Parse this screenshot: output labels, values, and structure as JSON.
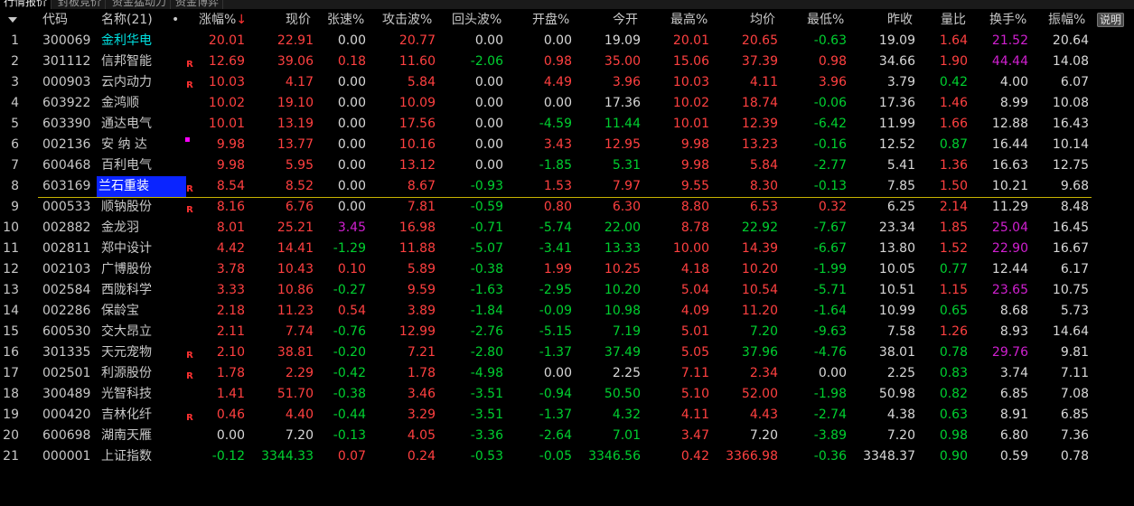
{
  "tabs": [
    "行情报价",
    "封板竞价",
    "资金猛动力",
    "资金博弈"
  ],
  "header": {
    "idx_blank": "",
    "code": "代码",
    "name": "名称(21)",
    "dot": "•",
    "zhangfu": "涨幅%",
    "sort_arrow": "↓",
    "xianjia": "现价",
    "zhangsu": "张速%",
    "gongji": "攻击波%",
    "huitou": "回头波%",
    "kaipan": "开盘%",
    "jinkai": "今开",
    "zuigao": "最高%",
    "junjia": "均价",
    "zuidi": "最低%",
    "zuoshou": "昨收",
    "liangbi": "量比",
    "huanshou": "换手%",
    "zhenfu": "振幅%",
    "help": "说明"
  },
  "colors": {
    "up": "#ff4040",
    "down": "#00d030",
    "flat": "#d8d8d8",
    "highlight": "#d020d0",
    "selection": "#0a24ff",
    "cyan": "#00e0e0"
  },
  "rows": [
    {
      "idx": "1",
      "code": "300069",
      "name": "金利华电",
      "mark": "",
      "zf": "20.01",
      "xj": "22.91",
      "zs": "0.00",
      "gj": "20.77",
      "ht": "0.00",
      "kp": "0.00",
      "jk": "19.09",
      "zg": "20.01",
      "jj": "20.65",
      "zd": "-0.63",
      "zs2": "19.09",
      "lb": "1.64",
      "hs": "21.52",
      "zhf": "20.64"
    },
    {
      "idx": "2",
      "code": "301112",
      "name": "信邦智能",
      "mark": "R",
      "zf": "12.69",
      "xj": "39.06",
      "zs": "0.18",
      "gj": "11.60",
      "ht": "-2.06",
      "kp": "0.98",
      "jk": "35.00",
      "zg": "15.06",
      "jj": "37.39",
      "zd": "0.98",
      "zs2": "34.66",
      "lb": "1.90",
      "hs": "44.44",
      "zhf": "14.08"
    },
    {
      "idx": "3",
      "code": "000903",
      "name": "云内动力",
      "mark": "R",
      "zf": "10.03",
      "xj": "4.17",
      "zs": "0.00",
      "gj": "5.84",
      "ht": "0.00",
      "kp": "4.49",
      "jk": "3.96",
      "zg": "10.03",
      "jj": "4.11",
      "zd": "3.96",
      "zs2": "3.79",
      "lb": "0.42",
      "hs": "4.00",
      "zhf": "6.07"
    },
    {
      "idx": "4",
      "code": "603922",
      "name": "金鸿顺",
      "mark": "",
      "zf": "10.02",
      "xj": "19.10",
      "zs": "0.00",
      "gj": "10.09",
      "ht": "0.00",
      "kp": "0.00",
      "jk": "17.36",
      "zg": "10.02",
      "jj": "18.74",
      "zd": "-0.06",
      "zs2": "17.36",
      "lb": "1.46",
      "hs": "8.99",
      "zhf": "10.08"
    },
    {
      "idx": "5",
      "code": "603390",
      "name": "通达电气",
      "mark": "",
      "zf": "10.01",
      "xj": "13.19",
      "zs": "0.00",
      "gj": "17.56",
      "ht": "0.00",
      "kp": "-4.59",
      "jk": "11.44",
      "zg": "10.01",
      "jj": "12.39",
      "zd": "-6.42",
      "zs2": "11.99",
      "lb": "1.66",
      "hs": "12.88",
      "zhf": "16.43"
    },
    {
      "idx": "6",
      "code": "002136",
      "name": "安 纳 达",
      "mark": "P",
      "zf": "9.98",
      "xj": "13.77",
      "zs": "0.00",
      "gj": "10.16",
      "ht": "0.00",
      "kp": "3.43",
      "jk": "12.95",
      "zg": "9.98",
      "jj": "13.23",
      "zd": "-0.16",
      "zs2": "12.52",
      "lb": "0.87",
      "hs": "16.44",
      "zhf": "10.14"
    },
    {
      "idx": "7",
      "code": "600468",
      "name": "百利电气",
      "mark": "",
      "zf": "9.98",
      "xj": "5.95",
      "zs": "0.00",
      "gj": "13.12",
      "ht": "0.00",
      "kp": "-1.85",
      "jk": "5.31",
      "zg": "9.98",
      "jj": "5.84",
      "zd": "-2.77",
      "zs2": "5.41",
      "lb": "1.36",
      "hs": "16.63",
      "zhf": "12.75"
    },
    {
      "idx": "8",
      "code": "603169",
      "name": "兰石重装",
      "mark": "R",
      "zf": "8.54",
      "xj": "8.52",
      "zs": "0.00",
      "gj": "8.67",
      "ht": "-0.93",
      "kp": "1.53",
      "jk": "7.97",
      "zg": "9.55",
      "jj": "8.30",
      "zd": "-0.13",
      "zs2": "7.85",
      "lb": "1.50",
      "hs": "10.21",
      "zhf": "9.68"
    },
    {
      "idx": "9",
      "code": "000533",
      "name": "顺钠股份",
      "mark": "R",
      "zf": "8.16",
      "xj": "6.76",
      "zs": "0.00",
      "gj": "7.81",
      "ht": "-0.59",
      "kp": "0.80",
      "jk": "6.30",
      "zg": "8.80",
      "jj": "6.53",
      "zd": "0.32",
      "zs2": "6.25",
      "lb": "2.14",
      "hs": "11.29",
      "zhf": "8.48"
    },
    {
      "idx": "10",
      "code": "002882",
      "name": "金龙羽",
      "mark": "",
      "zf": "8.01",
      "xj": "25.21",
      "zs": "3.45",
      "gj": "16.98",
      "ht": "-0.71",
      "kp": "-5.74",
      "jk": "22.00",
      "zg": "8.78",
      "jj": "22.92",
      "zd": "-7.67",
      "zs2": "23.34",
      "lb": "1.85",
      "hs": "25.04",
      "zhf": "16.45"
    },
    {
      "idx": "11",
      "code": "002811",
      "name": "郑中设计",
      "mark": "",
      "zf": "4.42",
      "xj": "14.41",
      "zs": "-1.29",
      "gj": "11.88",
      "ht": "-5.07",
      "kp": "-3.41",
      "jk": "13.33",
      "zg": "10.00",
      "jj": "14.39",
      "zd": "-6.67",
      "zs2": "13.80",
      "lb": "1.52",
      "hs": "22.90",
      "zhf": "16.67"
    },
    {
      "idx": "12",
      "code": "002103",
      "name": "广博股份",
      "mark": "",
      "zf": "3.78",
      "xj": "10.43",
      "zs": "0.10",
      "gj": "5.89",
      "ht": "-0.38",
      "kp": "1.99",
      "jk": "10.25",
      "zg": "4.18",
      "jj": "10.20",
      "zd": "-1.99",
      "zs2": "10.05",
      "lb": "0.77",
      "hs": "12.44",
      "zhf": "6.17"
    },
    {
      "idx": "13",
      "code": "002584",
      "name": "西陇科学",
      "mark": "",
      "zf": "3.33",
      "xj": "10.86",
      "zs": "-0.27",
      "gj": "9.59",
      "ht": "-1.63",
      "kp": "-2.95",
      "jk": "10.20",
      "zg": "5.04",
      "jj": "10.54",
      "zd": "-5.71",
      "zs2": "10.51",
      "lb": "1.15",
      "hs": "23.65",
      "zhf": "10.75"
    },
    {
      "idx": "14",
      "code": "002286",
      "name": "保龄宝",
      "mark": "",
      "zf": "2.18",
      "xj": "11.23",
      "zs": "0.54",
      "gj": "3.89",
      "ht": "-1.84",
      "kp": "-0.09",
      "jk": "10.98",
      "zg": "4.09",
      "jj": "11.20",
      "zd": "-1.64",
      "zs2": "10.99",
      "lb": "0.65",
      "hs": "8.68",
      "zhf": "5.73"
    },
    {
      "idx": "15",
      "code": "600530",
      "name": "交大昂立",
      "mark": "",
      "zf": "2.11",
      "xj": "7.74",
      "zs": "-0.76",
      "gj": "12.99",
      "ht": "-2.76",
      "kp": "-5.15",
      "jk": "7.19",
      "zg": "5.01",
      "jj": "7.20",
      "zd": "-9.63",
      "zs2": "7.58",
      "lb": "1.26",
      "hs": "8.93",
      "zhf": "14.64"
    },
    {
      "idx": "16",
      "code": "301335",
      "name": "天元宠物",
      "mark": "R",
      "zf": "2.10",
      "xj": "38.81",
      "zs": "-0.20",
      "gj": "7.21",
      "ht": "-2.80",
      "kp": "-1.37",
      "jk": "37.49",
      "zg": "5.05",
      "jj": "37.96",
      "zd": "-4.76",
      "zs2": "38.01",
      "lb": "0.78",
      "hs": "29.76",
      "zhf": "9.81"
    },
    {
      "idx": "17",
      "code": "002501",
      "name": "利源股份",
      "mark": "R",
      "zf": "1.78",
      "xj": "2.29",
      "zs": "-0.42",
      "gj": "1.78",
      "ht": "-4.98",
      "kp": "0.00",
      "jk": "2.25",
      "zg": "7.11",
      "jj": "2.34",
      "zd": "0.00",
      "zs2": "2.25",
      "lb": "0.83",
      "hs": "3.74",
      "zhf": "7.11"
    },
    {
      "idx": "18",
      "code": "300489",
      "name": "光智科技",
      "mark": "",
      "zf": "1.41",
      "xj": "51.70",
      "zs": "-0.38",
      "gj": "3.46",
      "ht": "-3.51",
      "kp": "-0.94",
      "jk": "50.50",
      "zg": "5.10",
      "jj": "52.00",
      "zd": "-1.98",
      "zs2": "50.98",
      "lb": "0.82",
      "hs": "6.85",
      "zhf": "7.08"
    },
    {
      "idx": "19",
      "code": "000420",
      "name": "吉林化纤",
      "mark": "R",
      "zf": "0.46",
      "xj": "4.40",
      "zs": "-0.44",
      "gj": "3.29",
      "ht": "-3.51",
      "kp": "-1.37",
      "jk": "4.32",
      "zg": "4.11",
      "jj": "4.43",
      "zd": "-2.74",
      "zs2": "4.38",
      "lb": "0.63",
      "hs": "8.91",
      "zhf": "6.85"
    },
    {
      "idx": "20",
      "code": "600698",
      "name": "湖南天雁",
      "mark": "",
      "zf": "0.00",
      "xj": "7.20",
      "zs": "-0.13",
      "gj": "4.05",
      "ht": "-3.36",
      "kp": "-2.64",
      "jk": "7.01",
      "zg": "3.47",
      "jj": "7.20",
      "zd": "-3.89",
      "zs2": "7.20",
      "lb": "0.98",
      "hs": "6.80",
      "zhf": "7.36"
    },
    {
      "idx": "21",
      "code": "000001",
      "name": "上证指数",
      "mark": "",
      "zf": "-0.12",
      "xj": "3344.33",
      "zs": "0.07",
      "gj": "0.24",
      "ht": "-0.53",
      "kp": "-0.05",
      "jk": "3346.56",
      "zg": "0.42",
      "jj": "3366.98",
      "zd": "-0.36",
      "zs2": "3348.37",
      "lb": "0.90",
      "hs": "0.59",
      "zhf": "0.78"
    }
  ]
}
